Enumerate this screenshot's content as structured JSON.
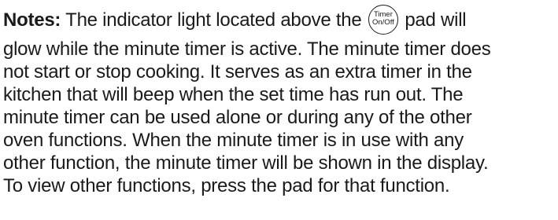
{
  "notes": {
    "label": "Notes:",
    "intro_before_icon": " The indicator light located above the ",
    "intro_after_icon": " pad will",
    "pad_icon": {
      "name": "timer-on-off-pad-icon",
      "top_text": "Timer",
      "bottom_text": "On/Off"
    },
    "lines": [
      "glow while the minute timer is active. The minute timer does",
      "not start or stop cooking. It serves as an extra timer in the",
      "kitchen that will beep when the set time has run out. The",
      "minute timer can be used alone or during any of the other",
      "oven functions. When the minute timer is in use with any",
      "other function, the minute timer will be shown in the display.",
      "To view other functions, press the pad for that function."
    ]
  }
}
